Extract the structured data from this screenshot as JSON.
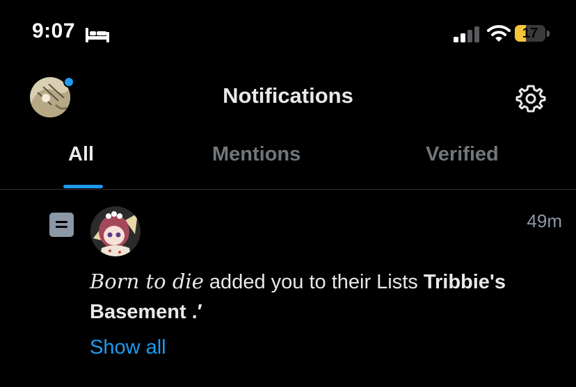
{
  "status_bar": {
    "time": "9:07",
    "battery_level": "17",
    "icons": [
      "bed-icon",
      "cellular-signal-icon",
      "wifi-icon",
      "battery-icon"
    ]
  },
  "header": {
    "title": "Notifications",
    "icons": [
      "profile-avatar",
      "gear-icon"
    ]
  },
  "tabs": [
    {
      "label": "All",
      "selected": true
    },
    {
      "label": "Mentions",
      "selected": false
    },
    {
      "label": "Verified",
      "selected": false
    }
  ],
  "notification": {
    "time_ago": "49m",
    "display_name": "Born to die",
    "action_text": " added you to their Lists ",
    "list_name": "Tribbie's Basement .′",
    "show_all_label": "Show all",
    "icons": [
      "list-icon",
      "user-avatar"
    ]
  },
  "colors": {
    "background": "#000000",
    "accent": "#1d9bf0",
    "muted_text": "#71767b",
    "battery_low": "#f4c53b"
  }
}
